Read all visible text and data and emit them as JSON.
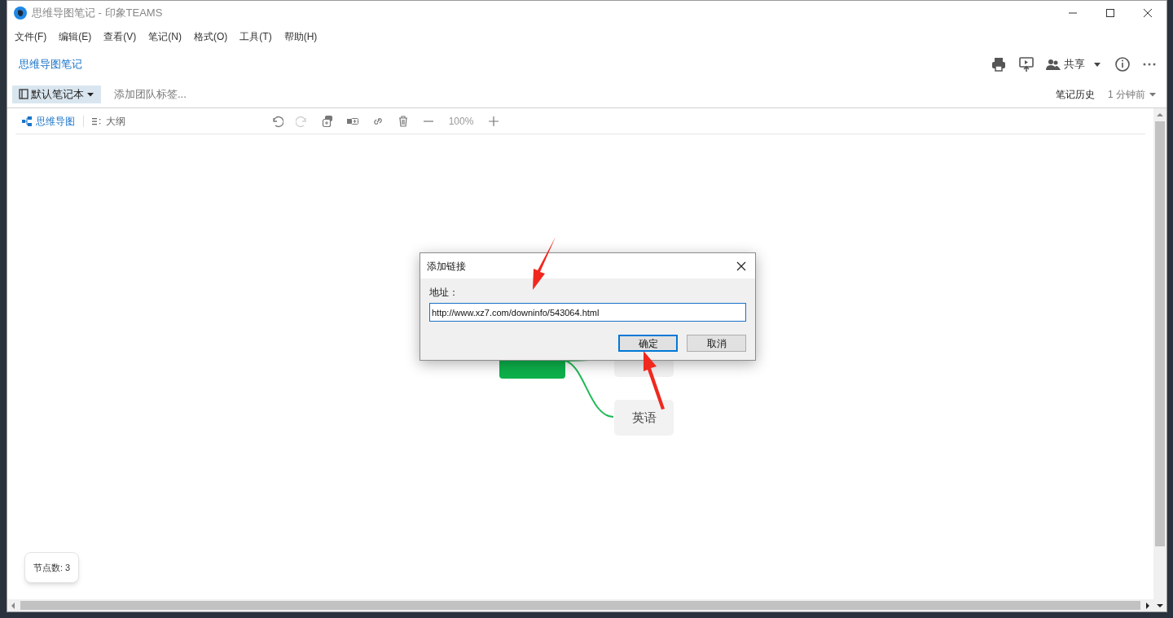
{
  "window": {
    "title": "思维导图笔记 - 印象TEAMS"
  },
  "menu": [
    "文件(F)",
    "编辑(E)",
    "查看(V)",
    "笔记(N)",
    "格式(O)",
    "工具(T)",
    "帮助(H)"
  ],
  "note": {
    "title": "思维导图笔记",
    "share": "共享",
    "notebook": "默认笔记本",
    "tag_placeholder": "添加团队标签...",
    "history": "笔记历史",
    "updated": "1 分钟前"
  },
  "view_tabs": [
    {
      "label": "思维导图",
      "selected": true
    },
    {
      "label": "大纲",
      "selected": false
    }
  ],
  "toolbar": [
    {
      "kind": "undo",
      "disabled": false
    },
    {
      "kind": "redo",
      "disabled": true
    },
    {
      "kind": "add-child",
      "disabled": false
    },
    {
      "kind": "add-sibling",
      "disabled": false
    },
    {
      "kind": "link",
      "disabled": false
    },
    {
      "kind": "delete",
      "disabled": false
    },
    {
      "kind": "zoom-out",
      "disabled": false
    },
    {
      "kind": "zoom-level",
      "text": "100%",
      "disabled": false
    },
    {
      "kind": "zoom-in",
      "disabled": false
    }
  ],
  "mindmap": {
    "nodes": [
      {
        "kind": "root"
      },
      {
        "kind": "child"
      },
      {
        "kind": "child",
        "text": "英语"
      }
    ]
  },
  "node_count": "节点数: 3",
  "dialog": {
    "title": "添加链接",
    "label": "地址：",
    "value": "http://www.xz7.com/downinfo/543064.html",
    "buttons": [
      {
        "label": "确定",
        "selected": true
      },
      {
        "label": "取消",
        "selected": false
      }
    ]
  }
}
